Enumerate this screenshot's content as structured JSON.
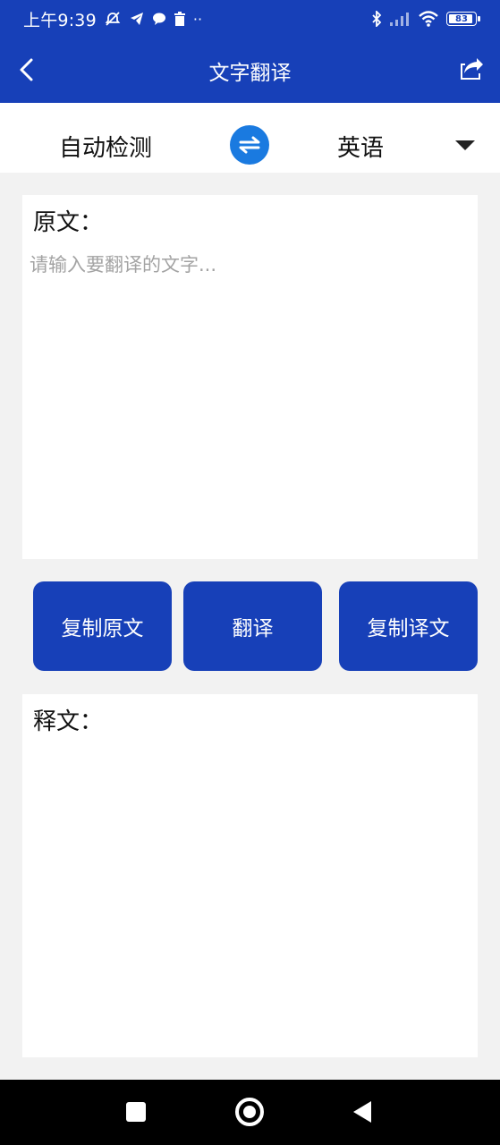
{
  "status_bar": {
    "time": "上午9:39",
    "more_indicator": "··",
    "battery": "83"
  },
  "app_bar": {
    "title": "文字翻译"
  },
  "language_bar": {
    "source_language": "自动检测",
    "target_language": "英语"
  },
  "source_panel": {
    "label": "原文：",
    "placeholder": "请输入要翻译的文字...",
    "value": ""
  },
  "actions": {
    "copy_source": "复制原文",
    "translate": "翻译",
    "copy_result": "复制译文"
  },
  "result_panel": {
    "label": "释文：",
    "value": ""
  },
  "colors": {
    "primary": "#1740b8",
    "swap_button": "#1a7ae0",
    "background": "#f2f2f2",
    "placeholder": "#a3a3a3"
  },
  "icons": {
    "back": "back-arrow-icon",
    "share": "share-icon",
    "swap": "swap-arrows-icon",
    "dropdown": "triangle-down-icon"
  }
}
